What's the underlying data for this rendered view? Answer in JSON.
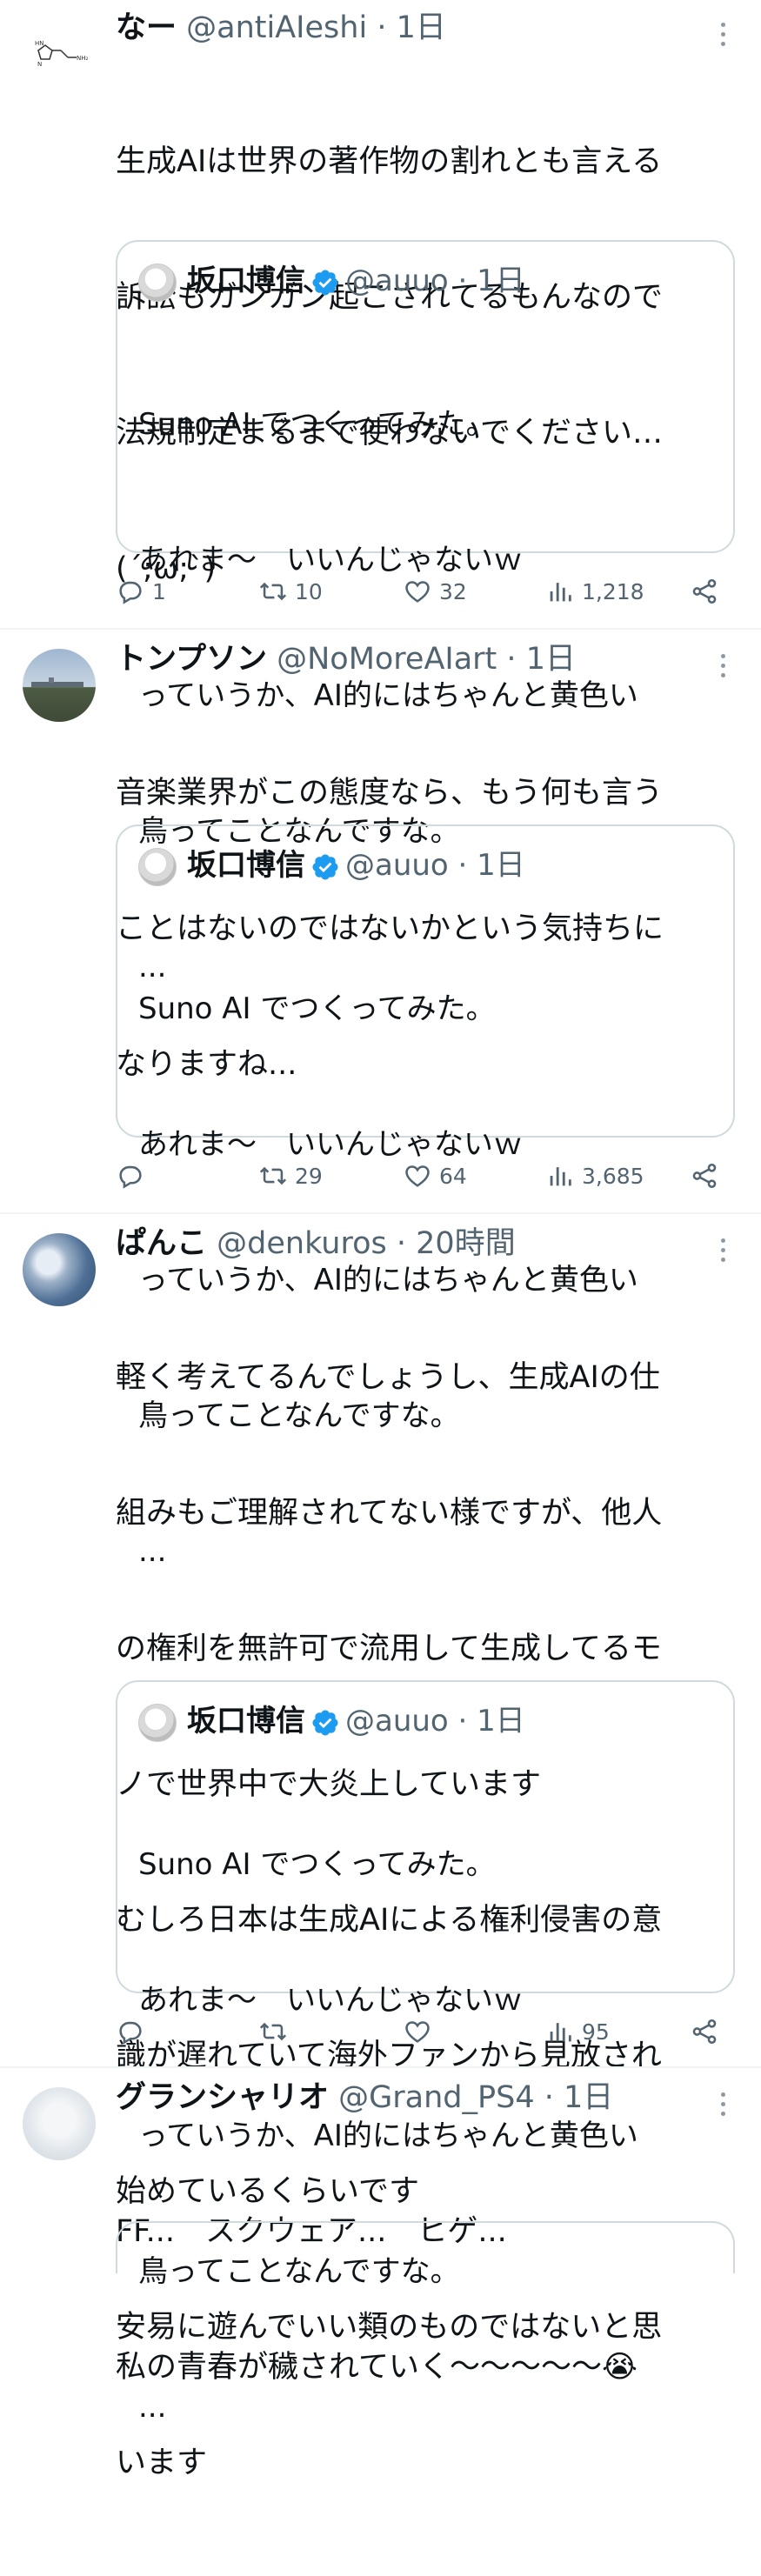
{
  "tweets": [
    {
      "name": "なー",
      "handle": "@antiAIeshi",
      "time": "1日",
      "text": "生成AIは世界の著作物の割れとも言える訴訟もガンガン起こされてるもんなので法規制定まるまで使わないでください…(´;ω;`)",
      "lines": [
        "生成AIは世界の著作物の割れとも言える",
        "訴訟もガンガン起こされてるもんなので",
        "法規制定まるまで使わないでください…",
        "(´;ω;`)"
      ],
      "quote": {
        "name": "坂口博信",
        "handle": "@auuo",
        "time": "1日",
        "lines": [
          "Suno AI でつくってみた。",
          "あれま〜　いいんじゃないｗ",
          "っていうか、AI的にはちゃんと黄色い",
          "鳥ってことなんですな。",
          "..."
        ]
      },
      "stats": {
        "replies": "1",
        "retweets": "10",
        "likes": "32",
        "views": "1,218"
      }
    },
    {
      "name": "トンプソン",
      "handle": "@NoMoreAIart",
      "time": "1日",
      "lines": [
        "音楽業界がこの態度なら、もう何も言う",
        "ことはないのではないかという気持ちに",
        "なりますね..."
      ],
      "quote": {
        "name": "坂口博信",
        "handle": "@auuo",
        "time": "1日",
        "lines": [
          "Suno AI でつくってみた。",
          "あれま〜　いいんじゃないｗ",
          "っていうか、AI的にはちゃんと黄色い",
          "鳥ってことなんですな。",
          "..."
        ]
      },
      "stats": {
        "replies": "",
        "retweets": "29",
        "likes": "64",
        "views": "3,685"
      }
    },
    {
      "name": "ぱんこ",
      "handle": "@denkuros",
      "time": "20時間",
      "lines": [
        "軽く考えてるんでしょうし、生成AIの仕",
        "組みもご理解されてない様ですが、他人",
        "の権利を無許可で流用して生成してるモ",
        "ノで世界中で大炎上しています",
        "むしろ日本は生成AIによる権利侵害の意",
        "識が遅れていて海外ファンから見放され",
        "始めているくらいです",
        "安易に遊んでいい類のものではないと思",
        "います"
      ],
      "quote": {
        "name": "坂口博信",
        "handle": "@auuo",
        "time": "1日",
        "lines": [
          "Suno AI でつくってみた。",
          "あれま〜　いいんじゃないｗ",
          "っていうか、AI的にはちゃんと黄色い",
          "鳥ってことなんですな。",
          "..."
        ]
      },
      "stats": {
        "replies": "",
        "retweets": "",
        "likes": "",
        "views": "95"
      }
    },
    {
      "name": "グランシャリオ",
      "handle": "@Grand_PS4",
      "time": "1日",
      "lines": [
        "FF...　スクウェア...　ヒゲ...",
        "私の青春が穢されていく〜〜〜〜〜😭"
      ]
    }
  ],
  "separator": "·"
}
